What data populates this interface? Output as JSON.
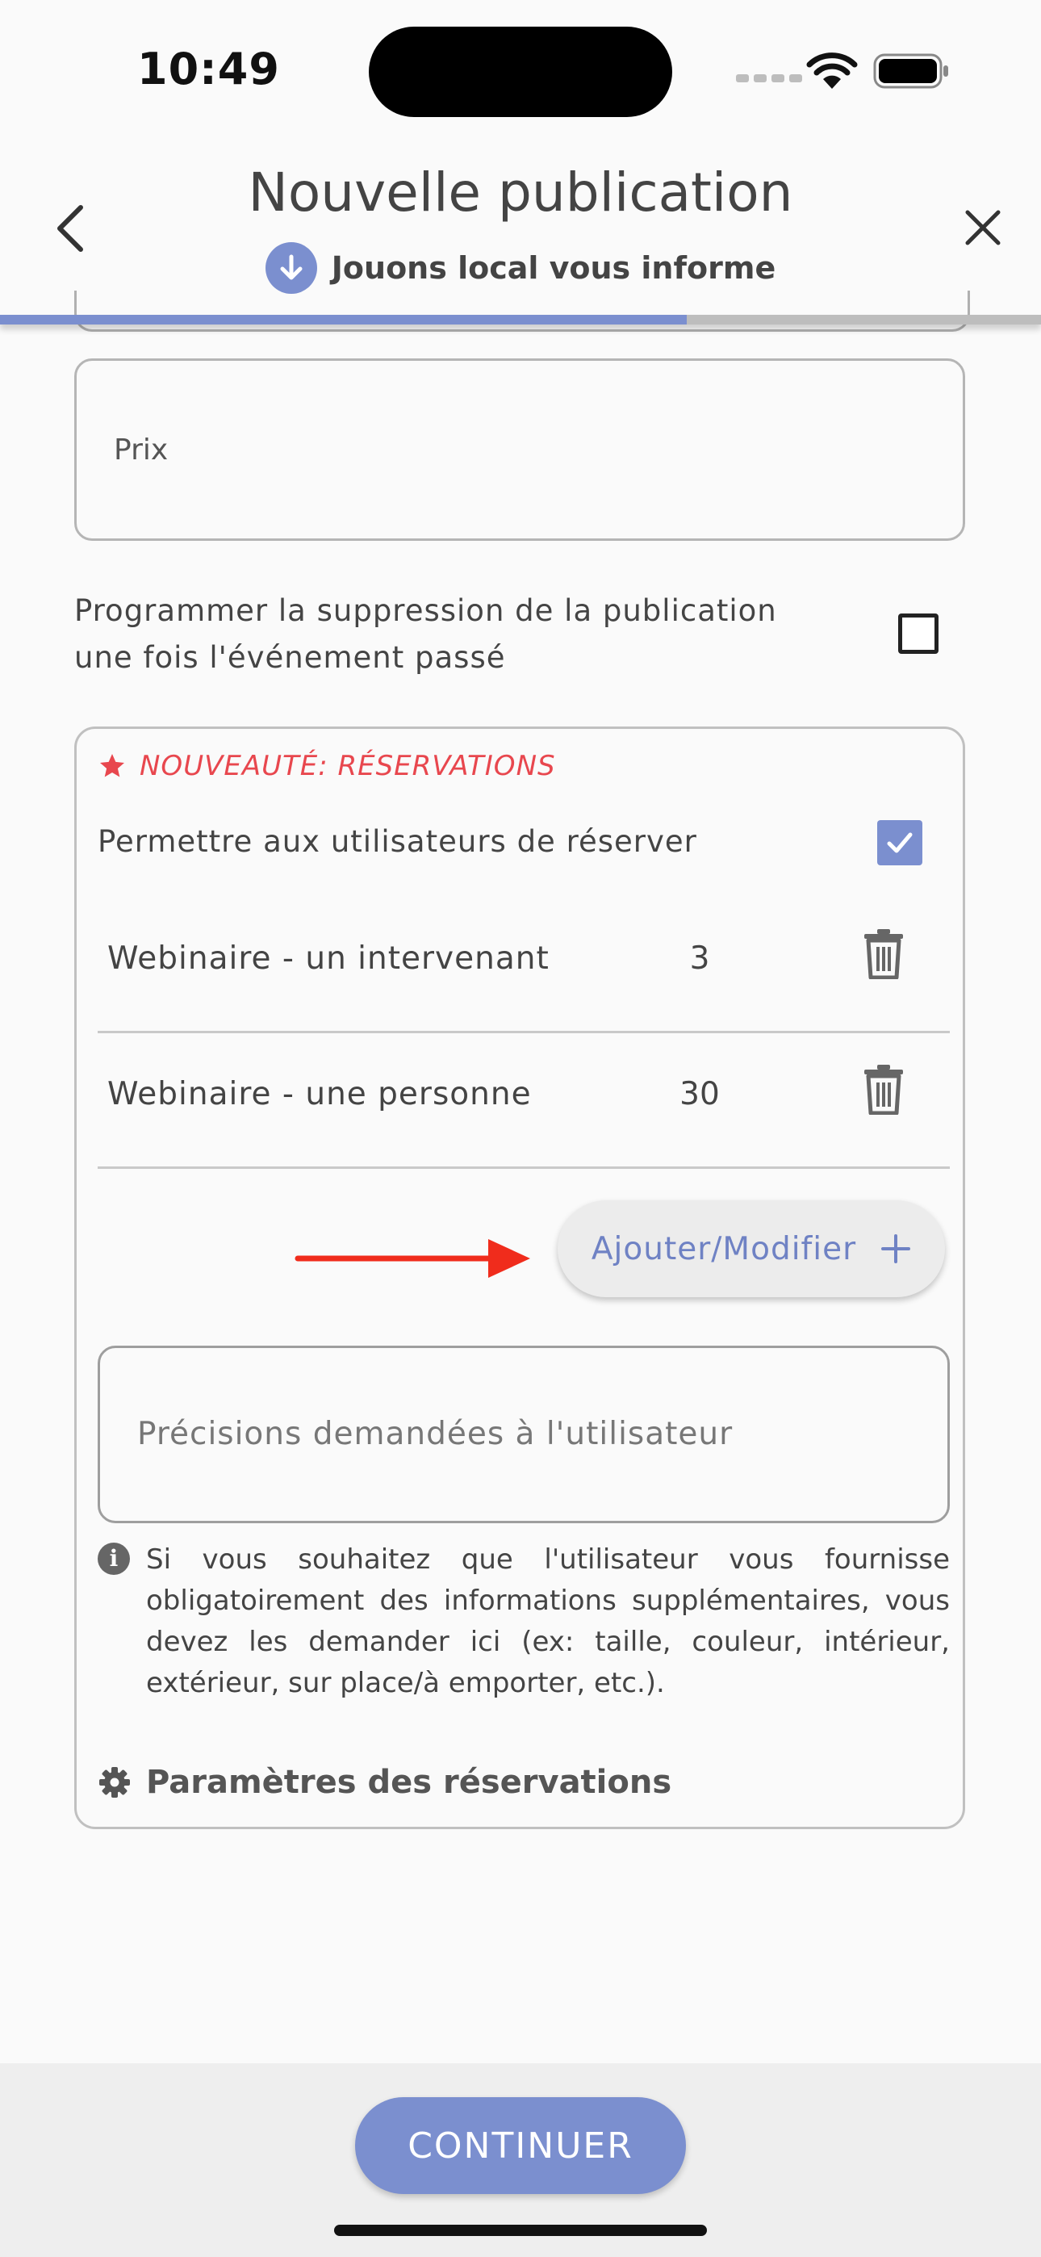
{
  "status_bar": {
    "time": "10:49"
  },
  "header": {
    "title": "Nouvelle publication",
    "subtitle": "Jouons local vous informe",
    "progress_fraction": 0.66
  },
  "form": {
    "price_label": "Prix",
    "schedule_delete_label": "Programmer la suppression de la publication une fois l'événement passé",
    "schedule_delete_checked": false
  },
  "reservations": {
    "badge": "NOUVEAUTÉ: RÉSERVATIONS",
    "allow_label": "Permettre aux utilisateurs de réserver",
    "allow_checked": true,
    "items": [
      {
        "label": "Webinaire - un intervenant",
        "count": "3"
      },
      {
        "label": "Webinaire - une personne",
        "count": "30"
      }
    ],
    "add_button_label": "Ajouter/Modifier",
    "details_placeholder": "Précisions demandées à l'utilisateur",
    "info_text": "Si vous souhaitez que l'utilisateur vous fournisse obligatoirement des informations supplémentaires, vous devez les demander ici (ex: taille, couleur, intérieur, extérieur, sur place/à emporter, etc.).",
    "settings_label": "Paramètres des réservations"
  },
  "footer": {
    "continue_label": "CONTINUER"
  },
  "colors": {
    "accent": "#7b8fcf",
    "alert_red": "#e8474e",
    "annotation_red": "#f02c1c"
  }
}
